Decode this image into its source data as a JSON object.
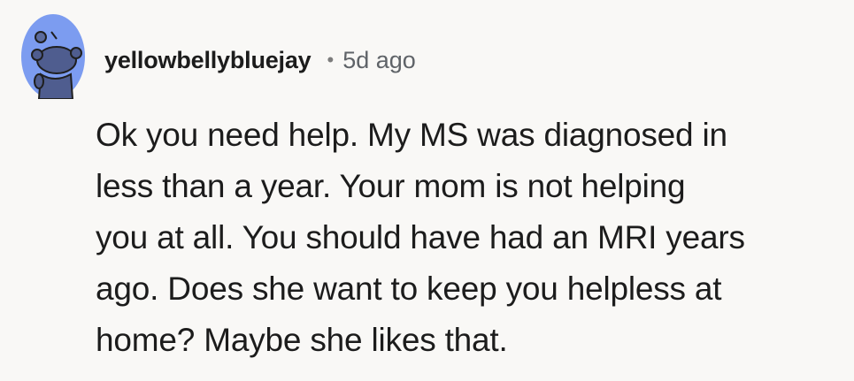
{
  "comment": {
    "author": "yellowbellybluejay",
    "separator": "•",
    "timestamp": "5d ago",
    "avatar_icon": "reddit-snoo-avatar-icon",
    "avatar_color": "#7c9cf0",
    "body_lines": [
      "Ok you need help. My MS was diagnosed in",
      "less than a year. Your mom is not helping",
      "you at all. You should have had an MRI years",
      "ago. Does she want to keep you helpless at",
      "home? Maybe she likes that."
    ]
  }
}
